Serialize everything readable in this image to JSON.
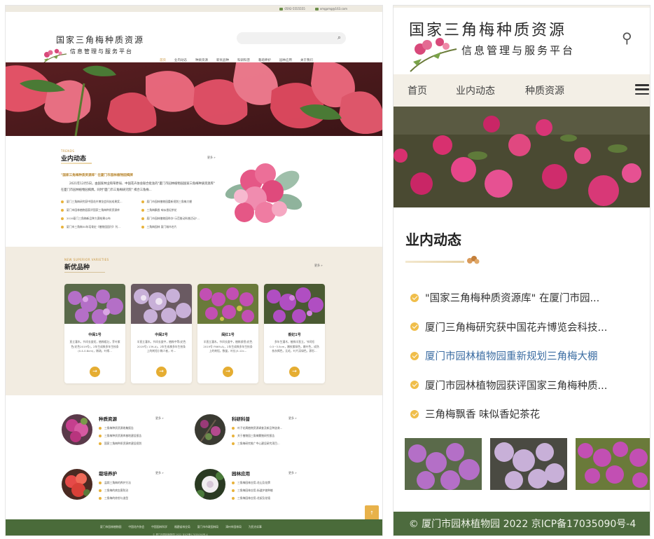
{
  "desktop": {
    "topbar": {
      "items": [
        "0592-5555555",
        "xmgpmg@163.com"
      ]
    },
    "header": {
      "title": "国家三角梅种质资源",
      "subtitle": "信息管理与服务平台",
      "search_placeholder": ""
    },
    "nav": [
      "首页",
      "业内动态",
      "种质资源",
      "新优品种",
      "科研科普",
      "栽培养护",
      "园林应用",
      "关于我们"
    ],
    "news": {
      "en": "TRENDS",
      "title": "业内动态",
      "more": "更多 »",
      "headline": "\"国家三角梅种质资源库\" 在厦门市园林植物园揭牌",
      "paragraph": "2021年12月5日，由国家林业和草原局、中国花卉协会联合批准的\"厦门市园林植物园国家三角梅种质资源库\" 在厦门市园林植物园揭牌。同时\"厦门市三角梅研究院\" 揭合三角梅...",
      "items": [
        "厦门三角梅研究获中国花卉博览会科技成果奖...",
        "厦门市园林植物园重新规划三角梅大棚",
        "厦门市园林植物园获评国家三角梅种质资源库",
        "三角梅飘香 味似香妃茶花",
        "2019厦门三角梅新品种大赛结果公布",
        "厦门市园林植物园举办\"示范推动科普活动\"...",
        "厦门市三角梅30年培育史《植物园园刊》刊...",
        "三角梅园林 厦门城市名片"
      ]
    },
    "varieties": {
      "en": "NEW SUPERIOR VARIETIES",
      "title": "新优品种",
      "more": "更多 »",
      "cards": [
        {
          "name": "中闽1号",
          "desc": "直立灌木。节间长度短，植株粗壮，芽叶紫色(花色2019号)，2年生成株多年生枝条(0.4-0.8cm)，稀疏，叶缘..."
        },
        {
          "name": "中闽2号",
          "desc": "半直立灌木。节间长度中，植株中等(花色2019号) 139-A)，2年生成株多年生枝条上的刺短小稀少者，叶..."
        },
        {
          "name": "闽红1号",
          "desc": "半直立灌木。节间长度中，植株紧密(花色2019号 FN69-A)，2年生成株多年生枝条上的刺短，数量，叶长(3-12c..."
        },
        {
          "name": "香妃1号",
          "desc": "多年生灌木，植株半直立，节间短0.5~3.5cm，嫩枝紫绿色，嫩叶色，成熟枝灰褐色，无毛，叶片深绿色，卵形..."
        }
      ]
    },
    "categories": [
      {
        "title": "种质资源",
        "more": "更多 »",
        "items": [
          "三角梅种质资源收集报告",
          "三角梅种质资源库基地建设报告",
          "国家三角梅种质资源库建设规划"
        ]
      },
      {
        "title": "科研科普",
        "more": "更多 »",
        "items": [
          "叶子花属植物资源调查及新品种选育...",
          "关于植物园三角梅繁殖研究报告",
          "三角梅研究推广中心建设研究项目..."
        ]
      },
      {
        "title": "栽培养护",
        "more": "更多 »",
        "items": [
          "盆栽三角梅的养护方法",
          "三角梅的病虫害防治",
          "三角梅的修剪与造型"
        ]
      },
      {
        "title": "园林应用",
        "more": "更多 »",
        "items": [
          "三角梅园林应用-花山及花牌",
          "三角梅园林应用-街道护坡种植",
          "三角梅园林应用-花架及花墙"
        ]
      }
    ],
    "footer": {
      "links": [
        "厦门市园林植物园",
        "中国花卉协会",
        "中国园林科学",
        "福建省林业局",
        "厦门市市政园林局",
        "漳州市园林局",
        "为民办实事"
      ],
      "copyright": "© 厦门市园林植物园 2022 京ICP备17035090号-4"
    },
    "back_to_top": "↑"
  },
  "mobile": {
    "title": "国家三角梅种质资源",
    "subtitle": "信息管理与服务平台",
    "nav": [
      "首页",
      "业内动态",
      "种质资源"
    ],
    "section_title": "业内动态",
    "news": [
      "\"国家三角梅种质资源库\" 在厦门市园...",
      "厦门三角梅研究获中国花卉博览会科技...",
      "厦门市园林植物园重新规划三角梅大棚",
      "厦门市园林植物园获评国家三角梅种质...",
      "三角梅飘香 味似香妃茶花"
    ],
    "highlighted_index": 2,
    "footer": "© 厦门市园林植物园 2022 京ICP备17035090号-4"
  },
  "colors": {
    "accent": "#c9943a",
    "bullet": "#e8b33c",
    "footer_green": "#4a6b3a",
    "beige": "#f2ece1",
    "link_blue": "#3d6ea3"
  }
}
